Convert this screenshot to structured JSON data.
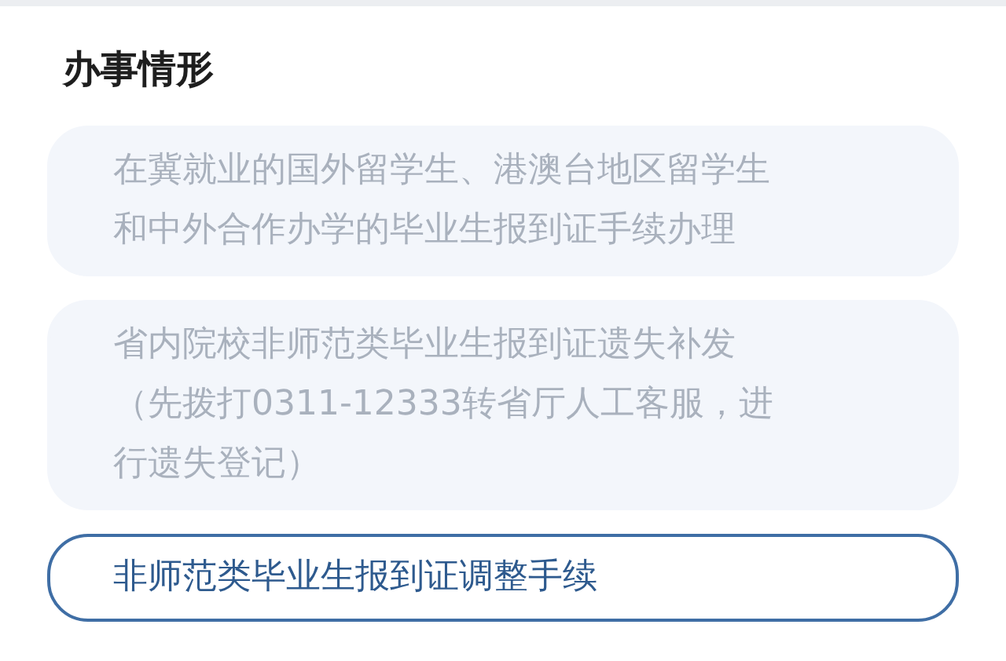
{
  "section": {
    "title": "办事情形"
  },
  "options": [
    {
      "label": "在冀就业的国外留学生、港澳台地区留学生和中外合作办学的毕业生报到证手续办理",
      "selected": false
    },
    {
      "label": "省内院校非师范类毕业生报到证遗失补发（先拨打0311-12333转省厅人工客服，进行遗失登记）",
      "selected": false
    },
    {
      "label": "非师范类毕业生报到证调整手续",
      "selected": true
    }
  ]
}
